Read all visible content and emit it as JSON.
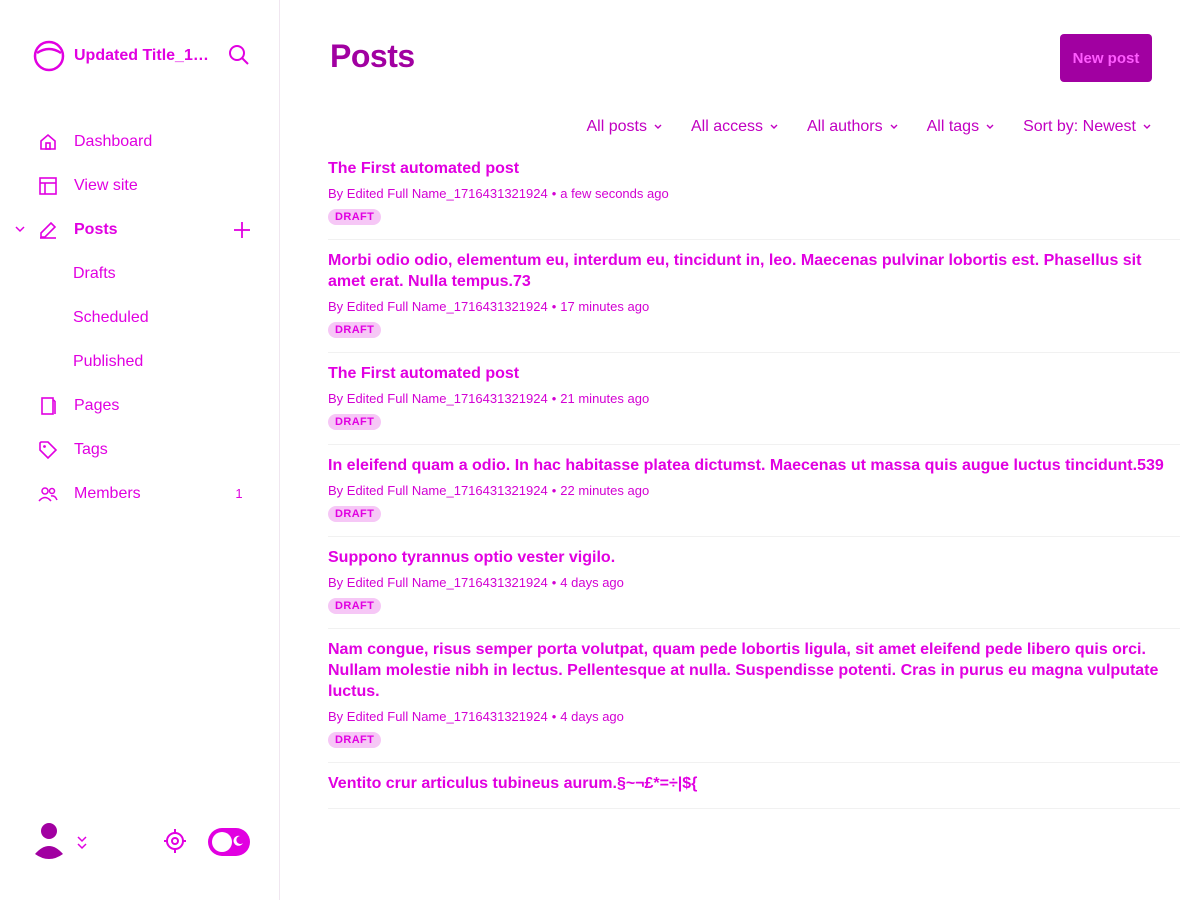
{
  "brand": {
    "title": "Updated Title_17..."
  },
  "nav": {
    "dashboard": "Dashboard",
    "view_site": "View site",
    "posts": "Posts",
    "drafts": "Drafts",
    "scheduled": "Scheduled",
    "published": "Published",
    "pages": "Pages",
    "tags": "Tags",
    "members": "Members",
    "members_count": "1"
  },
  "header": {
    "title": "Posts",
    "new_post_label": "New post"
  },
  "filters": [
    {
      "label": "All posts"
    },
    {
      "label": "All access"
    },
    {
      "label": "All authors"
    },
    {
      "label": "All tags"
    },
    {
      "label": "Sort by: Newest"
    }
  ],
  "posts": [
    {
      "title": "The First automated post",
      "author": "By Edited Full Name_1716431321924",
      "time": "a few seconds ago",
      "status": "DRAFT"
    },
    {
      "title": "Morbi odio odio, elementum eu, interdum eu, tincidunt in, leo. Maecenas pulvinar lobortis est. Phasellus sit amet erat. Nulla tempus.73",
      "author": "By Edited Full Name_1716431321924",
      "time": "17 minutes ago",
      "status": "DRAFT"
    },
    {
      "title": "The First automated post",
      "author": "By Edited Full Name_1716431321924",
      "time": "21 minutes ago",
      "status": "DRAFT"
    },
    {
      "title": "In eleifend quam a odio. In hac habitasse platea dictumst. Maecenas ut massa quis augue luctus tincidunt.539",
      "author": "By Edited Full Name_1716431321924",
      "time": "22 minutes ago",
      "status": "DRAFT"
    },
    {
      "title": "Suppono tyrannus optio vester vigilo.",
      "author": "By Edited Full Name_1716431321924",
      "time": "4 days ago",
      "status": "DRAFT"
    },
    {
      "title": "Nam congue, risus semper porta volutpat, quam pede lobortis ligula, sit amet eleifend pede libero quis orci. Nullam molestie nibh in lectus. Pellentesque at nulla. Suspendisse potenti. Cras in purus eu magna vulputate luctus.",
      "author": "By Edited Full Name_1716431321924",
      "time": "4 days ago",
      "status": "DRAFT"
    },
    {
      "title": "Ventito crur articulus tubineus aurum.§~¬£*=÷|${",
      "author": "",
      "time": "",
      "status": ""
    }
  ],
  "colors": {
    "accent": "#e100e1",
    "accent_dark": "#a100a1"
  }
}
